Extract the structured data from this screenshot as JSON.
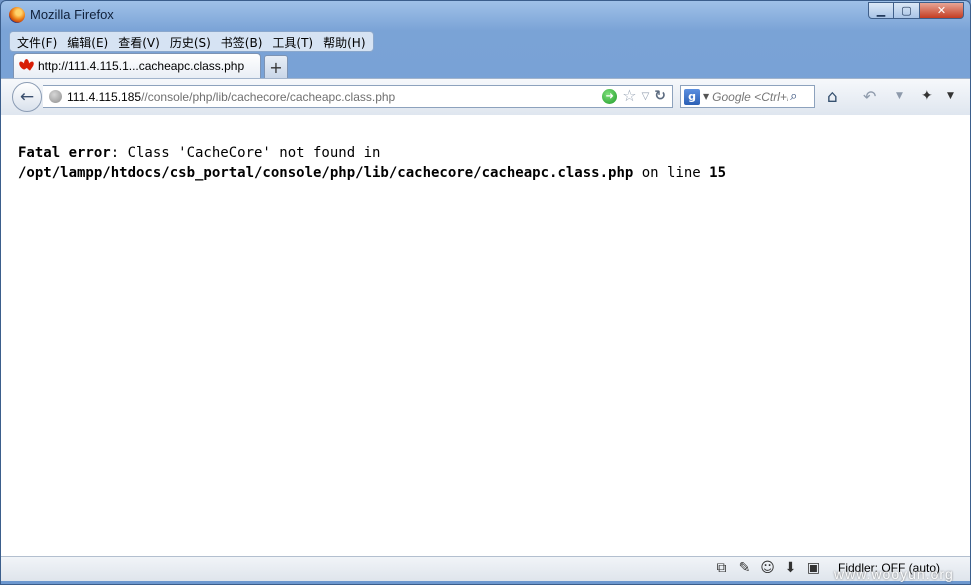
{
  "window": {
    "title": "Mozilla Firefox",
    "controls": {
      "minimize": "▁",
      "maximize": "▢",
      "close": "✕"
    }
  },
  "menubar": {
    "items": [
      {
        "label": "文件(F)"
      },
      {
        "label": "编辑(E)"
      },
      {
        "label": "查看(V)"
      },
      {
        "label": "历史(S)"
      },
      {
        "label": "书签(B)"
      },
      {
        "label": "工具(T)"
      },
      {
        "label": "帮助(H)"
      }
    ]
  },
  "tabs": [
    {
      "label": "http://111.4.115.1...cacheapc.class.php",
      "favicon": "huawei-icon",
      "active": true
    }
  ],
  "new_tab_label": "+",
  "navbar": {
    "url_host": "111.4.115.185",
    "url_path": "//console/php/lib/cachecore/cacheapc.class.php",
    "search_placeholder": "Google <Ctrl+K>",
    "search_engine_letter": "g"
  },
  "content": {
    "error_label": "Fatal error",
    "error_sep": ": Class 'CacheCore' not found in ",
    "error_path": "/opt/lampp/htdocs/csb_portal/console/php/lib/cachecore/cacheapc.class.php",
    "error_line_text": " on line ",
    "error_line": "15"
  },
  "statusbar": {
    "fiddler": "Fiddler: OFF (auto)"
  },
  "watermark": "www.wooyun.org",
  "colors": {
    "titlebar": "#7aa3d6",
    "close_button": "#c43c22",
    "go_button": "#1f9a2a",
    "huawei_red": "#d81e06"
  }
}
